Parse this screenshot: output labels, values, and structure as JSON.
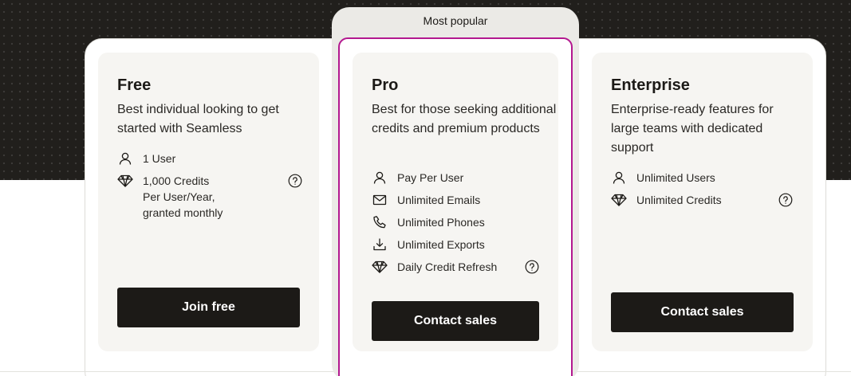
{
  "popular_badge": "Most popular",
  "plans": [
    {
      "name": "Free",
      "description": "Best individual looking to get started with Seamless",
      "features": [
        {
          "icon": "user-icon",
          "text": "1 User"
        },
        {
          "icon": "diamond-icon",
          "lines": [
            "1,000 Credits",
            "Per User/Year,",
            "granted monthly"
          ],
          "help": true
        }
      ],
      "cta": "Join free"
    },
    {
      "name": "Pro",
      "description": "Best for those seeking additional credits and premium products",
      "features": [
        {
          "icon": "user-icon",
          "text": "Pay Per User"
        },
        {
          "icon": "mail-icon",
          "text": "Unlimited Emails"
        },
        {
          "icon": "phone-icon",
          "text": "Unlimited Phones"
        },
        {
          "icon": "download-icon",
          "text": "Unlimited Exports"
        },
        {
          "icon": "diamond-icon",
          "text": "Daily Credit Refresh",
          "help": true
        }
      ],
      "cta": "Contact sales"
    },
    {
      "name": "Enterprise",
      "description": "Enterprise-ready features for large teams with dedicated support",
      "features": [
        {
          "icon": "user-icon",
          "text": "Unlimited Users"
        },
        {
          "icon": "diamond-icon",
          "text": "Unlimited Credits",
          "help": true
        }
      ],
      "cta": "Contact sales"
    }
  ],
  "colors": {
    "hero_background": "#211f1c",
    "highlight_border": "#b3188f",
    "button_background": "#1c1a17",
    "card_background": "#f6f5f2"
  }
}
